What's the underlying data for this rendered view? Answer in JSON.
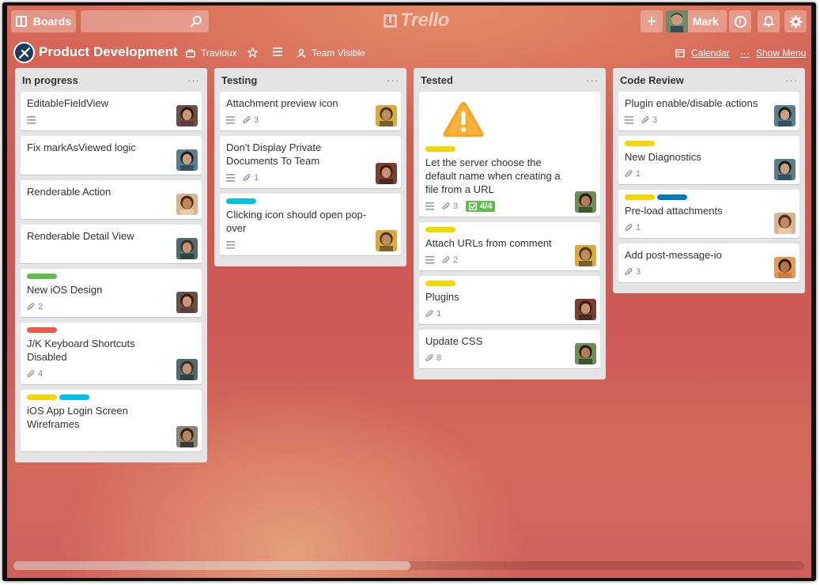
{
  "header": {
    "boards_label": "Boards",
    "search_value": "",
    "logo_text": "Trello",
    "user_name": "Mark"
  },
  "board": {
    "title": "Product Development",
    "team": "Travidux",
    "visibility": "Team Visible",
    "calendar_label": "Calendar",
    "menu_label": "Show Menu"
  },
  "colors": {
    "green": "#61bd4f",
    "yellow": "#f2d600",
    "red": "#eb5a46",
    "sky": "#00c2e0",
    "blue": "#0079bf"
  },
  "lists": [
    {
      "title": "In progress",
      "cards": [
        {
          "title": "EditableFieldView",
          "labels": [],
          "description": true,
          "attachments": null,
          "checklist": null,
          "avatar": "woman-dark-hair"
        },
        {
          "title": "Fix markAsViewed logic",
          "labels": [],
          "description": false,
          "attachments": null,
          "checklist": null,
          "avatar": "man-glasses"
        },
        {
          "title": "Renderable Action",
          "labels": [],
          "description": false,
          "attachments": null,
          "checklist": null,
          "avatar": "woman-curly"
        },
        {
          "title": "Renderable Detail View",
          "labels": [],
          "description": false,
          "attachments": null,
          "checklist": null,
          "avatar": "man-beanie"
        },
        {
          "title": "New iOS Design",
          "labels": [
            "green"
          ],
          "description": false,
          "attachments": "2",
          "checklist": null,
          "avatar": "woman-dark-hair"
        },
        {
          "title": "J/K Keyboard Shortcuts Disabled",
          "labels": [
            "red"
          ],
          "description": false,
          "attachments": "4",
          "checklist": null,
          "avatar": "man-beanie"
        },
        {
          "title": "iOS App Login Screen Wireframes",
          "labels": [
            "yellow",
            "sky"
          ],
          "description": false,
          "attachments": null,
          "checklist": null,
          "avatar": "man-smile"
        }
      ]
    },
    {
      "title": "Testing",
      "cards": [
        {
          "title": "Attachment preview icon",
          "labels": [],
          "description": true,
          "attachments": "3",
          "checklist": null,
          "avatar": "man-yellow"
        },
        {
          "title": "Don't Display Private Documents To Team",
          "labels": [],
          "description": true,
          "attachments": "1",
          "checklist": null,
          "avatar": "woman-red"
        },
        {
          "title": "Clicking icon should open pop-over",
          "labels": [
            "sky"
          ],
          "description": true,
          "attachments": null,
          "checklist": null,
          "avatar": "man-yellow"
        }
      ]
    },
    {
      "title": "Tested",
      "cards": [
        {
          "title": "Let the server choose the default name when creating a file from a URL",
          "cover": "warning-icon",
          "labels": [
            "yellow"
          ],
          "description": true,
          "attachments": "3",
          "checklist": "4/4",
          "avatar": "woman-green"
        },
        {
          "title": "Attach URLs from comment",
          "labels": [
            "yellow"
          ],
          "description": true,
          "attachments": "2",
          "checklist": null,
          "avatar": "man-yellow"
        },
        {
          "title": "Plugins",
          "labels": [
            "yellow"
          ],
          "description": false,
          "attachments": "1",
          "checklist": null,
          "avatar": "woman-red"
        },
        {
          "title": "Update CSS",
          "labels": [],
          "description": false,
          "attachments": "8",
          "checklist": null,
          "avatar": "woman-green"
        }
      ]
    },
    {
      "title": "Code Review",
      "cards": [
        {
          "title": "Plugin enable/disable actions",
          "labels": [],
          "description": true,
          "attachments": "3",
          "checklist": null,
          "avatar": "man-glasses"
        },
        {
          "title": "New Diagnostics",
          "labels": [
            "yellow"
          ],
          "description": false,
          "attachments": "1",
          "checklist": null,
          "avatar": "man-glasses"
        },
        {
          "title": "Pre-load attachments",
          "labels": [
            "yellow",
            "blue"
          ],
          "description": false,
          "attachments": "1",
          "checklist": null,
          "avatar": "woman-curly"
        },
        {
          "title": "Add post-message-io",
          "labels": [],
          "description": false,
          "attachments": "3",
          "checklist": null,
          "avatar": "woman-orange"
        }
      ]
    }
  ]
}
